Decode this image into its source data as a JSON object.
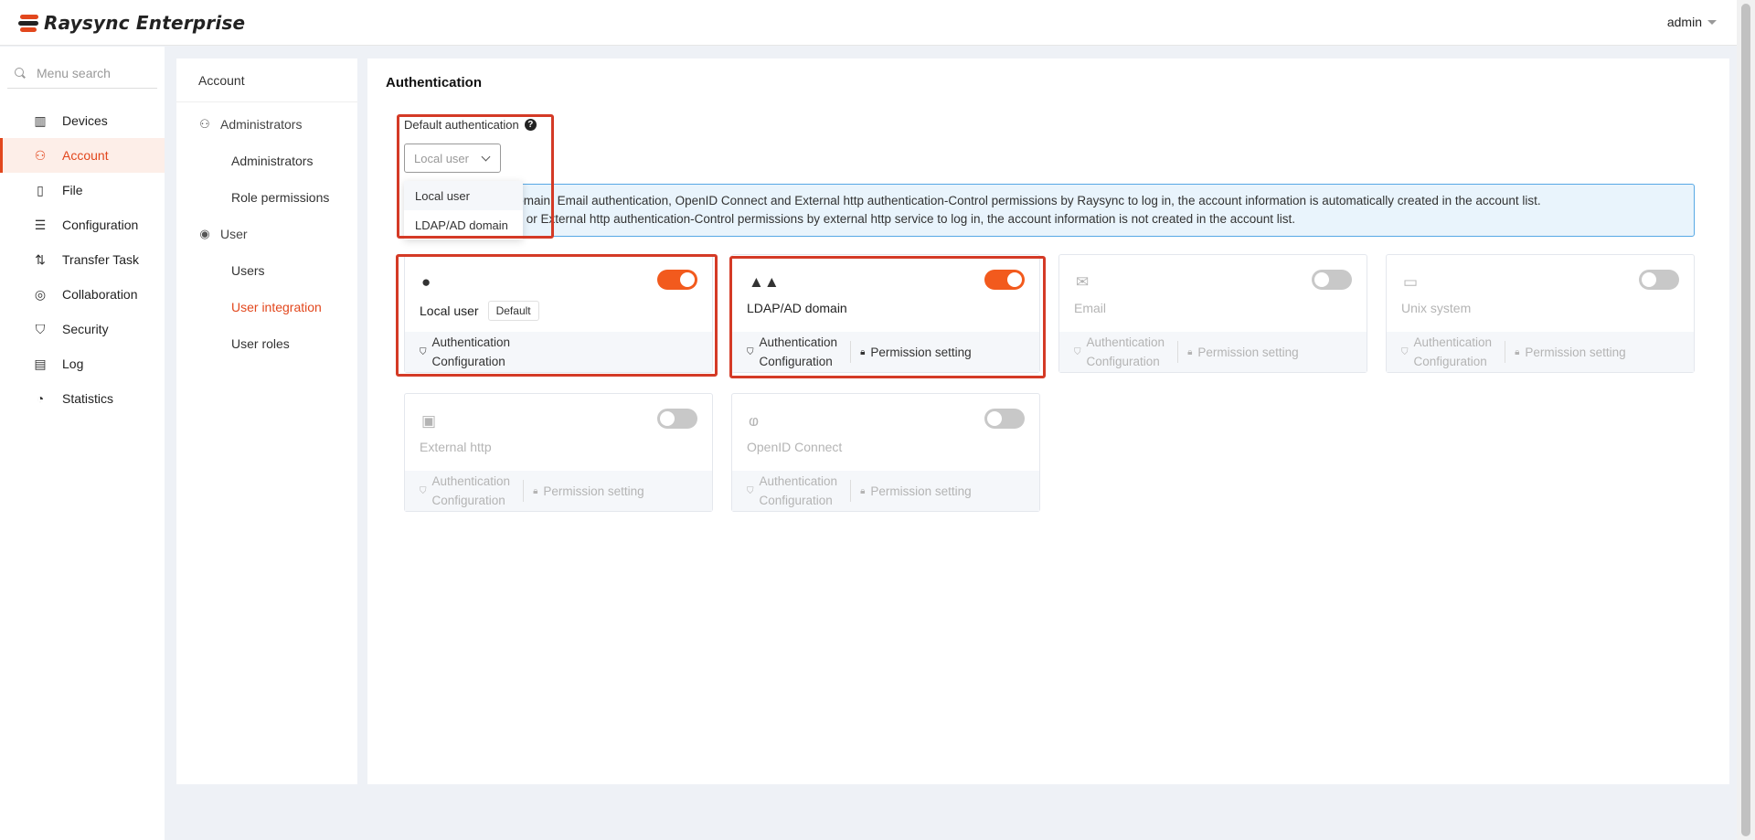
{
  "app": {
    "title": "Raysync Enterprise",
    "user": "admin"
  },
  "sidebar": {
    "search_placeholder": "Menu search",
    "items": [
      {
        "label": "Devices",
        "icon": "devices-icon",
        "active": false
      },
      {
        "label": "Account",
        "icon": "account-icon",
        "active": true
      },
      {
        "label": "File",
        "icon": "file-icon",
        "active": false
      },
      {
        "label": "Configuration",
        "icon": "configuration-icon",
        "active": false
      },
      {
        "label": "Transfer Task",
        "icon": "transfer-icon",
        "active": false
      },
      {
        "label": "Collaboration",
        "icon": "collaboration-icon",
        "active": false
      },
      {
        "label": "Security",
        "icon": "shield-icon",
        "active": false
      },
      {
        "label": "Log",
        "icon": "log-icon",
        "active": false
      },
      {
        "label": "Statistics",
        "icon": "pie-chart-icon",
        "active": false
      }
    ]
  },
  "subpanel": {
    "title": "Account",
    "admin_group": "Administrators",
    "admin_items": [
      "Administrators",
      "Role permissions"
    ],
    "user_group": "User",
    "user_items": [
      "Users",
      "User integration",
      "User roles"
    ]
  },
  "main": {
    "title": "Authentication",
    "default_auth_label": "Default authentication",
    "select_value": "Local user",
    "dropdown_options": [
      "Local user",
      "LDAP/AD domain"
    ],
    "info_line1": "Select LDAP/AD domain, Email authentication, OpenID Connect and External http authentication-Control permissions by Raysync to log in, the account information is automatically created in the account list.",
    "info_line2": "Select Unix System or External http authentication-Control permissions by external http service to log in, the account information is not created in the account list.",
    "auth_config_line1": "Authentication",
    "auth_config_line2": "Configuration",
    "permission_setting": "Permission setting",
    "default_badge": "Default",
    "cards": [
      {
        "name": "Local user",
        "enabled": true,
        "icon": "user-icon"
      },
      {
        "name": "LDAP/AD domain",
        "enabled": true,
        "icon": "mountains-icon"
      },
      {
        "name": "Email",
        "enabled": false,
        "icon": "email-icon"
      },
      {
        "name": "Unix system",
        "enabled": false,
        "icon": "linux-icon"
      },
      {
        "name": "External http",
        "enabled": false,
        "icon": "http-icon"
      },
      {
        "name": "OpenID Connect",
        "enabled": false,
        "icon": "openid-icon"
      }
    ]
  },
  "colors": {
    "accent": "#f25a1d",
    "highlight": "#d43a26",
    "info_border": "#57a8e5"
  }
}
